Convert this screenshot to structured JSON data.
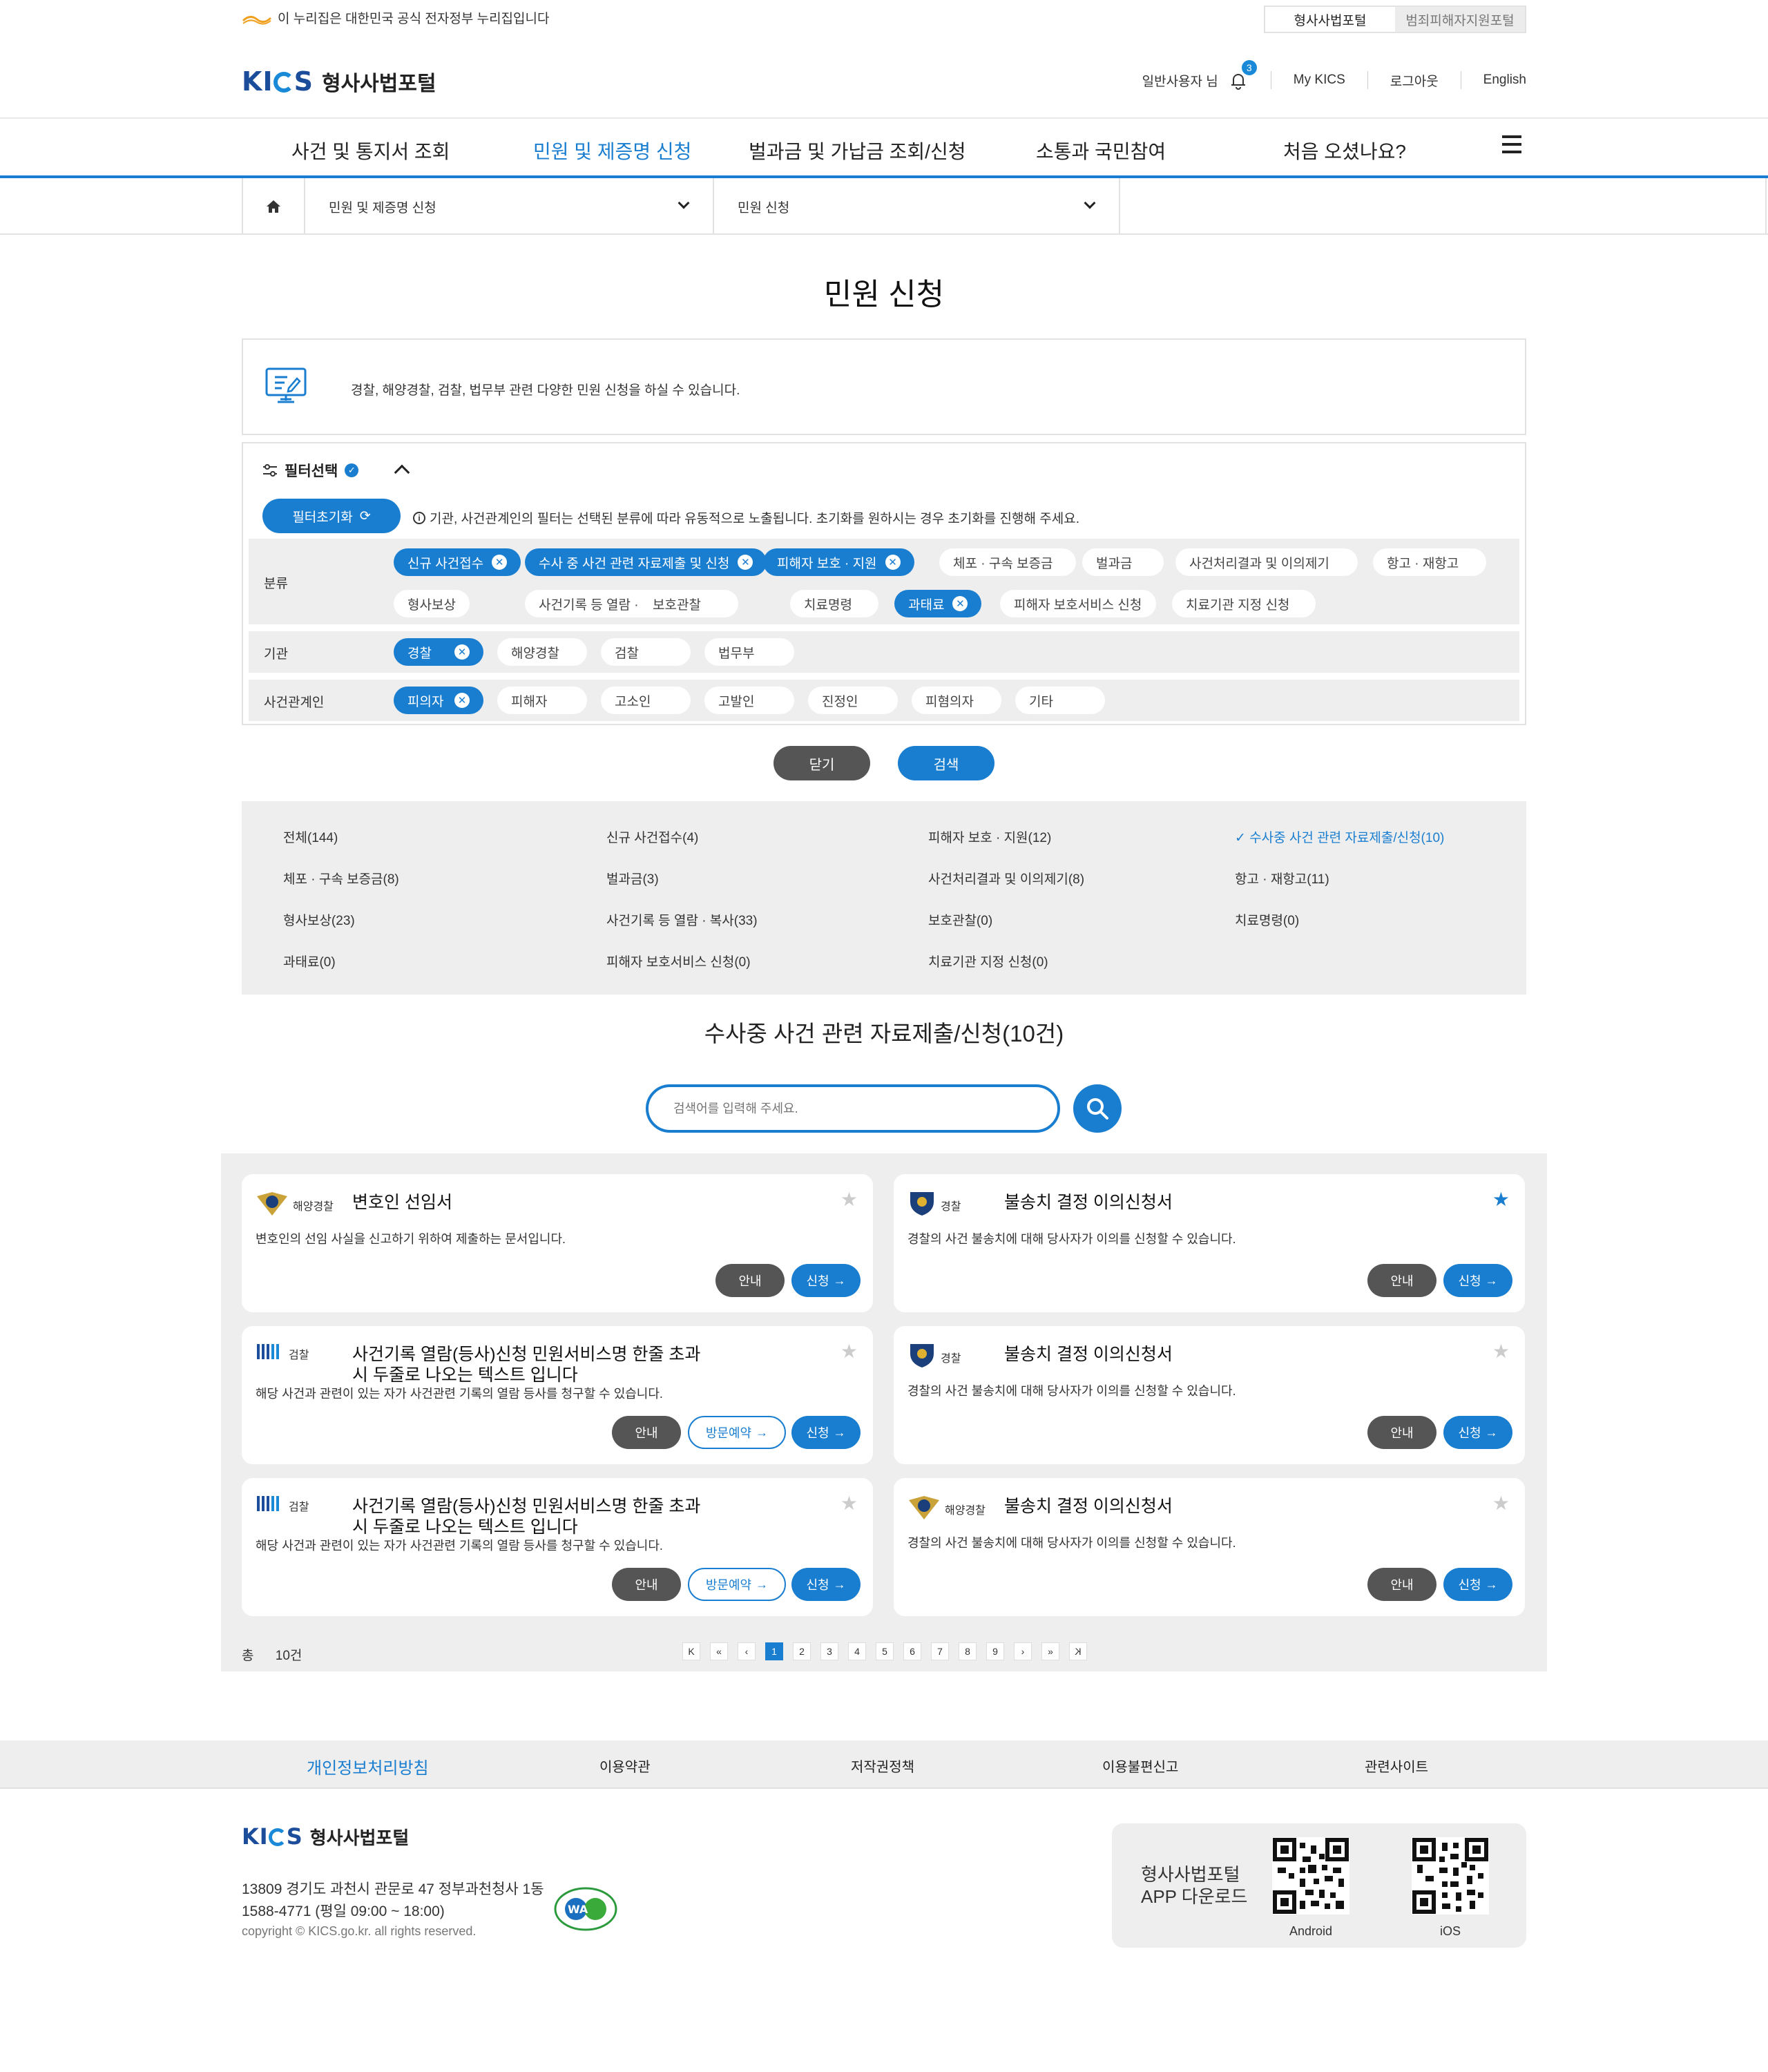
{
  "topbar": {
    "gov_notice": "이 누리집은 대한민국 공식 전자정부 누리집입니다",
    "portals": [
      "형사사법포털",
      "범죄피해자지원포털"
    ]
  },
  "header": {
    "logo_text": "형사사법포털",
    "user": "일반사용자 님",
    "notif_count": "3",
    "links": [
      "My KICS",
      "로그아웃",
      "English"
    ]
  },
  "gnb": {
    "items": [
      "사건 및 통지서 조회",
      "민원 및 제증명 신청",
      "벌과금 및 가납금 조회/신청",
      "소통과 국민참여",
      "처음 오셨나요?"
    ],
    "active": 1
  },
  "breadcrumb": {
    "level1": "민원 및 제증명 신청",
    "level2": "민원 신청"
  },
  "page": {
    "title": "민원 신청",
    "info": "경찰, 해양경찰, 검찰, 법무부 관련 다양한 민원 신청을 하실 수 있습니다."
  },
  "filter": {
    "title": "필터선택",
    "reset_label": "필터초기화",
    "note": "기관, 사건관계인의 필터는 선택된 분류에 따라 유동적으로 노출됩니다. 초기화를 원하시는 경우 초기화를 진행해 주세요.",
    "rows": [
      {
        "label": "분류",
        "chips": [
          {
            "text": "신규 사건접수",
            "on": true
          },
          {
            "text": "수사 중 사건 관련 자료제출 및 신청",
            "on": true
          },
          {
            "text": "피해자 보호 · 지원",
            "on": true
          },
          {
            "text": "체포 · 구속 보증금",
            "on": false
          },
          {
            "text": "벌과금",
            "on": false
          },
          {
            "text": "사건처리결과 및 이의제기",
            "on": false
          },
          {
            "text": "항고 · 재항고",
            "on": false
          },
          {
            "text": "형사보상",
            "on": false
          },
          {
            "text": "사건기록 등 열람 · 복사",
            "on": false
          },
          {
            "text": "보호관찰",
            "on": false
          },
          {
            "text": "치료명령",
            "on": false
          },
          {
            "text": "과태료",
            "on": true
          },
          {
            "text": "피해자 보호서비스 신청",
            "on": false
          },
          {
            "text": "치료기관 지정 신청",
            "on": false
          }
        ]
      },
      {
        "label": "기관",
        "chips": [
          {
            "text": "경찰",
            "on": true
          },
          {
            "text": "해양경찰",
            "on": false
          },
          {
            "text": "검찰",
            "on": false
          },
          {
            "text": "법무부",
            "on": false
          }
        ]
      },
      {
        "label": "사건관계인",
        "chips": [
          {
            "text": "피의자",
            "on": true
          },
          {
            "text": "피해자",
            "on": false
          },
          {
            "text": "고소인",
            "on": false
          },
          {
            "text": "고발인",
            "on": false
          },
          {
            "text": "진정인",
            "on": false
          },
          {
            "text": "피혐의자",
            "on": false
          },
          {
            "text": "기타",
            "on": false
          }
        ]
      }
    ],
    "close_label": "닫기",
    "search_label": "검색"
  },
  "categories": [
    {
      "text": "전체(144)",
      "on": false
    },
    {
      "text": "신규 사건접수(4)",
      "on": false
    },
    {
      "text": "피해자 보호 · 지원(12)",
      "on": false
    },
    {
      "text": "수사중 사건 관련 자료제출/신청(10)",
      "on": true
    },
    {
      "text": "체포 · 구속 보증금(8)",
      "on": false
    },
    {
      "text": "벌과금(3)",
      "on": false
    },
    {
      "text": "사건처리결과 및 이의제기(8)",
      "on": false
    },
    {
      "text": "항고 · 재항고(11)",
      "on": false
    },
    {
      "text": "형사보상(23)",
      "on": false
    },
    {
      "text": "사건기록 등 열람 · 복사(33)",
      "on": false
    },
    {
      "text": "보호관찰(0)",
      "on": false
    },
    {
      "text": "치료명령(0)",
      "on": false
    },
    {
      "text": "과태료(0)",
      "on": false
    },
    {
      "text": "피해자 보호서비스 신청(0)",
      "on": false
    },
    {
      "text": "치료기관 지정 신청(0)",
      "on": false
    }
  ],
  "results": {
    "title": "수사중 사건 관련 자료제출/신청(10건)",
    "search_placeholder": "검색어를 입력해 주세요.",
    "guide_label": "안내",
    "apply_label": "신청",
    "visit_label": "방문예약",
    "cards": [
      {
        "org": "해양경찰",
        "title": "변호인 선임서",
        "desc": "변호인의 선임 사실을 신고하기 위하여 제출하는 문서입니다.",
        "starred": false,
        "visit": false
      },
      {
        "org": "경찰",
        "title": "불송치 결정 이의신청서",
        "desc": "경찰의 사건 불송치에 대해 당사자가 이의를 신청할 수 있습니다.",
        "starred": true,
        "visit": false
      },
      {
        "org": "검찰",
        "title": "사건기록 열람(등사)신청 민원서비스명 한줄 초과시 두줄로 나오는 텍스트 입니다",
        "desc": "해당 사건과 관련이 있는 자가 사건관련 기록의 열람 등사를 청구할 수 있습니다.",
        "starred": false,
        "visit": true
      },
      {
        "org": "경찰",
        "title": "불송치 결정 이의신청서",
        "desc": "경찰의 사건 불송치에 대해 당사자가 이의를 신청할 수 있습니다.",
        "starred": false,
        "visit": false
      },
      {
        "org": "검찰",
        "title": "사건기록 열람(등사)신청 민원서비스명 한줄 초과시 두줄로 나오는 텍스트 입니다",
        "desc": "해당 사건과 관련이 있는 자가 사건관련 기록의 열람 등사를 청구할 수 있습니다.",
        "starred": false,
        "visit": true
      },
      {
        "org": "해양경찰",
        "title": "불송치 결정 이의신청서",
        "desc": "경찰의 사건 불송치에 대해 당사자가 이의를 신청할 수 있습니다.",
        "starred": false,
        "visit": false
      }
    ],
    "total_label": "총",
    "total_value": "10건",
    "pages": [
      "1",
      "2",
      "3",
      "4",
      "5",
      "6",
      "7",
      "8",
      "9"
    ],
    "current_page": "1"
  },
  "footer": {
    "links": [
      "개인정보처리방침",
      "이용약관",
      "저작권정책",
      "이용불편신고",
      "관련사이트"
    ],
    "logo_text": "형사사법포털",
    "address": "13809 경기도 과천시 관문로 47 정부과천청사 1동",
    "phone": "1588-4771 (평일 09:00 ~ 18:00)",
    "copyright": "copyright © KICS.go.kr. all rights reserved.",
    "app_title_1": "형사사법포털",
    "app_title_2": "APP 다운로드",
    "app_android": "Android",
    "app_ios": "iOS"
  },
  "colors": {
    "accent": "#1a7ed0",
    "brand": "#1b4d9b",
    "panel": "#eeeeee"
  }
}
